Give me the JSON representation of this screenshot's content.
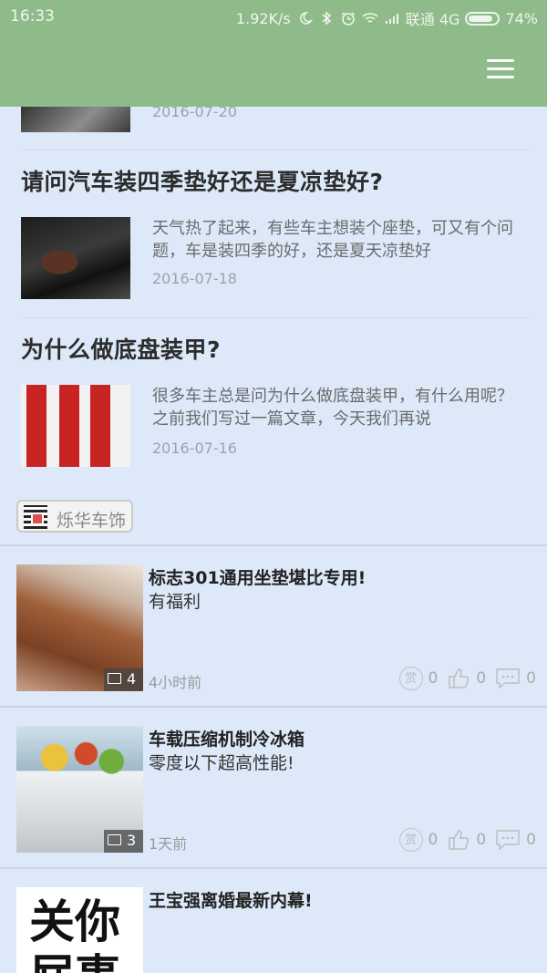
{
  "status_bar": {
    "time": "16:33",
    "speed": "1.92K/s",
    "carrier": "联通 4G",
    "battery": "74%"
  },
  "header": {
    "menu_icon": "hamburger-menu-icon"
  },
  "partial_article": {
    "date": "2016-07-20"
  },
  "articles": [
    {
      "title": "请问汽车装四季垫好还是夏凉垫好?",
      "desc": "天气热了起来，有些车主想装个座垫，可又有个问题，车是装四季的好，还是夏天凉垫好",
      "date": "2016-07-18"
    },
    {
      "title": "为什么做底盘装甲?",
      "desc": "很多车主总是问为什么做底盘装甲，有什么用呢？之前我们写过一篇文章，今天我们再说",
      "date": "2016-07-16"
    }
  ],
  "source_chip": {
    "label": "烁华车饰"
  },
  "posts": [
    {
      "title": "标志301通用坐垫堪比专用!",
      "sub": "有福利",
      "img_count": "4",
      "time": "4小时前",
      "reward_label": "赏",
      "rewards": "0",
      "likes": "0",
      "comments": "0"
    },
    {
      "title": "车载压缩机制冷冰箱",
      "sub": "零度以下超高性能!",
      "img_count": "3",
      "time": "1天前",
      "reward_label": "赏",
      "rewards": "0",
      "likes": "0",
      "comments": "0"
    },
    {
      "title": "王宝强离婚最新内幕!",
      "thumb_text": "关你\n屁事"
    }
  ],
  "colors": {
    "header": "#8fbb8a",
    "background": "#dde9f9"
  }
}
